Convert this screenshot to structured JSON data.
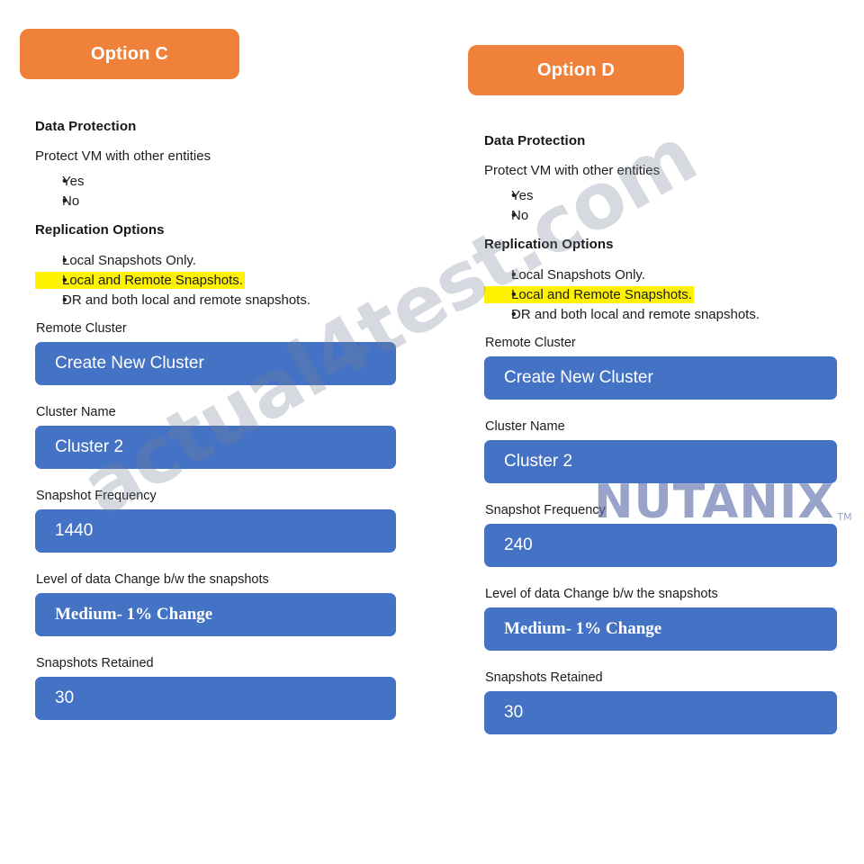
{
  "colors": {
    "option_button_orange": "#F0813A",
    "field_blue": "#4472C4",
    "highlight_yellow": "#FFF200",
    "watermark_gray": "rgba(120,130,150,0.30)",
    "logo_blue": "#5a6bab",
    "logo_green": "#8CC63F"
  },
  "watermarks": {
    "site_text": "actual4test.com",
    "logo_word": "NUTANIX",
    "logo_tm": "TM"
  },
  "options": [
    {
      "button_label": "Option C",
      "section_title": "Data Protection",
      "question": "Protect VM with other entities",
      "answers": [
        {
          "label": "Yes",
          "highlighted": false
        },
        {
          "label": "No",
          "highlighted": false
        }
      ],
      "replication_title": "Replication Options",
      "replication_choices": [
        {
          "label": "Local Snapshots Only.",
          "highlighted": false
        },
        {
          "label": "Local and Remote Snapshots.",
          "highlighted": true
        },
        {
          "label": "DR and both local and remote snapshots.",
          "highlighted": false
        }
      ],
      "fields": [
        {
          "label": "Remote Cluster",
          "value": "Create New Cluster",
          "serif": false
        },
        {
          "label": "Cluster Name",
          "value": "Cluster 2",
          "serif": false
        },
        {
          "label": "Snapshot Frequency",
          "value": "1440",
          "serif": false
        },
        {
          "label": "Level of data Change b/w the snapshots",
          "value": "Medium- 1% Change",
          "serif": true
        },
        {
          "label": "Snapshots Retained",
          "value": "30",
          "serif": false
        }
      ]
    },
    {
      "button_label": "Option D",
      "section_title": "Data Protection",
      "question": "Protect VM with other entities",
      "answers": [
        {
          "label": "Yes",
          "highlighted": false
        },
        {
          "label": "No",
          "highlighted": false
        }
      ],
      "replication_title": "Replication Options",
      "replication_choices": [
        {
          "label": "Local Snapshots Only.",
          "highlighted": false
        },
        {
          "label": "Local and Remote Snapshots.",
          "highlighted": true
        },
        {
          "label": "DR and both local and remote snapshots.",
          "highlighted": false
        }
      ],
      "fields": [
        {
          "label": "Remote Cluster",
          "value": "Create New Cluster",
          "serif": false
        },
        {
          "label": "Cluster Name",
          "value": "Cluster 2",
          "serif": false
        },
        {
          "label": "Snapshot Frequency",
          "value": "240",
          "serif": false
        },
        {
          "label": "Level of data Change b/w the snapshots",
          "value": "Medium- 1% Change",
          "serif": true
        },
        {
          "label": "Snapshots Retained",
          "value": "30",
          "serif": false
        }
      ]
    }
  ]
}
